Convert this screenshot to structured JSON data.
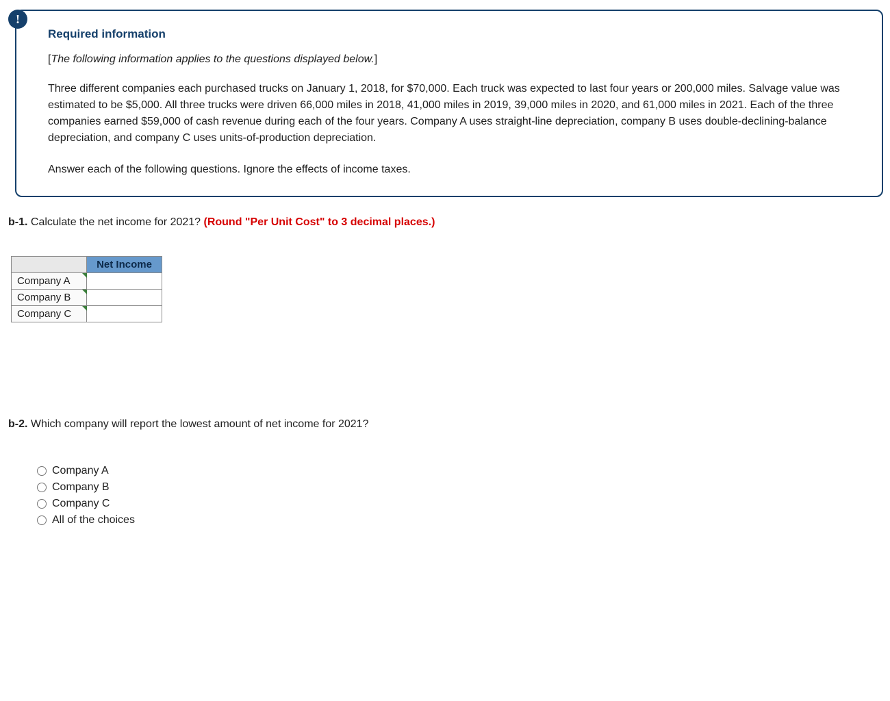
{
  "info_badge_glyph": "!",
  "required_heading": "Required information",
  "applies_text": "The following information applies to the questions displayed below.",
  "para1": "Three different companies each purchased trucks on January 1, 2018, for $70,000. Each truck was expected to last four years or 200,000 miles. Salvage value was estimated to be $5,000. All three trucks were driven 66,000 miles in 2018, 41,000 miles in 2019, 39,000 miles in 2020, and 61,000 miles in 2021. Each of the three companies earned $59,000 of cash revenue during each of the four years. Company A uses straight-line depreciation, company B uses double-declining-balance depreciation, and company C uses units-of-production depreciation.",
  "para2": "Answer each of the following questions. Ignore the effects of income taxes.",
  "b1": {
    "num": "b-1.",
    "text": " Calculate the net income for 2021? ",
    "red": "(Round \"Per Unit Cost\" to 3 decimal places.)"
  },
  "table": {
    "header": "Net Income",
    "rows": [
      {
        "label": "Company A",
        "value": ""
      },
      {
        "label": "Company B",
        "value": ""
      },
      {
        "label": "Company C",
        "value": ""
      }
    ]
  },
  "b2": {
    "num": "b-2.",
    "text": " Which company will report the lowest amount of net income for 2021?"
  },
  "choices": [
    "Company A",
    "Company B",
    "Company C",
    "All of the choices"
  ]
}
